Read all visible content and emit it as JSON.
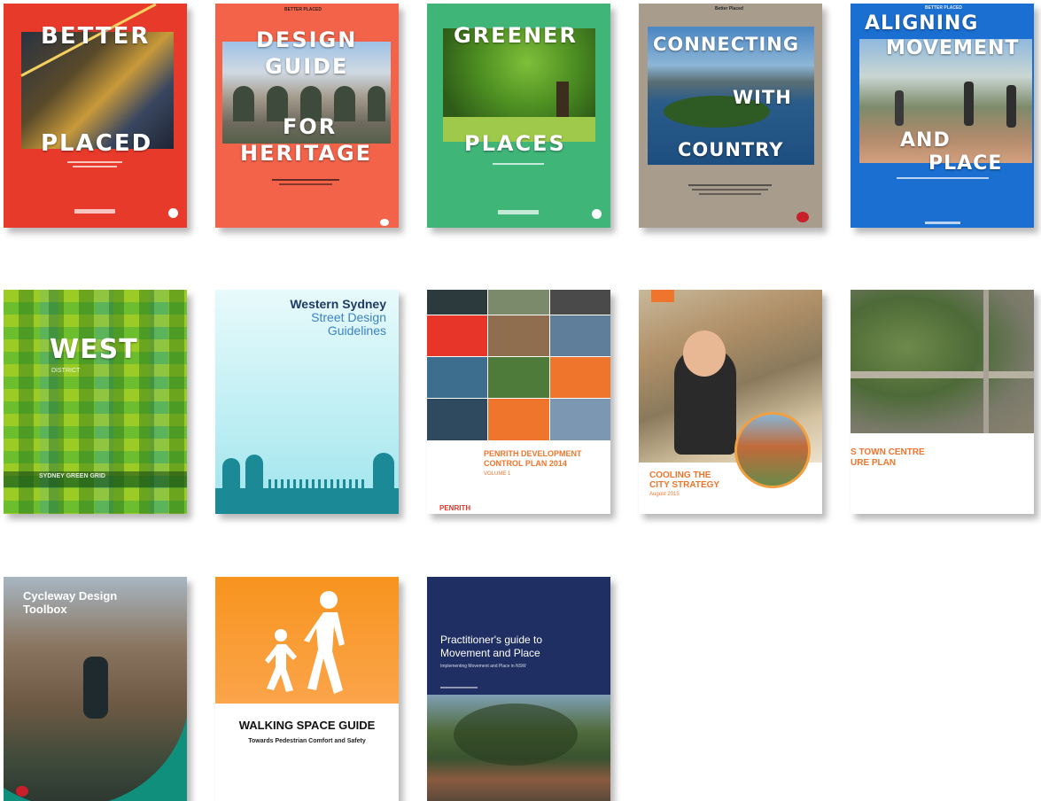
{
  "colors": {
    "better_placed_red": "#e83a2a",
    "heritage_coral": "#f2634a",
    "greener_green": "#3fb578",
    "country_taupe": "#a89d8d",
    "aligning_blue": "#1a6fd1",
    "practitioner_navy": "#1f2f63",
    "walking_orange": "#f7931e",
    "penrith_orange": "#f0752c"
  },
  "covers": [
    {
      "id": "better-placed",
      "title_lines": [
        "BETTER",
        "PLACED"
      ]
    },
    {
      "id": "design-guide-heritage",
      "header": "BETTER PLACED",
      "title_lines": [
        "DESIGN",
        "GUIDE",
        "FOR",
        "HERITAGE"
      ]
    },
    {
      "id": "greener-places",
      "title_lines": [
        "GREENER",
        "PLACES"
      ]
    },
    {
      "id": "connecting-with-country",
      "header": "Better Placed",
      "title_lines": [
        "CONNECTING",
        "WITH",
        "COUNTRY"
      ]
    },
    {
      "id": "aligning-movement-place",
      "header": "BETTER PLACED",
      "title_lines": [
        "ALIGNING",
        "MOVEMENT",
        "AND",
        "PLACE"
      ]
    },
    {
      "id": "west-district",
      "title": "WEST",
      "subtitle": "DISTRICT",
      "footer": "SYDNEY GREEN GRID"
    },
    {
      "id": "western-sydney-street-design",
      "title_line1": "Western Sydney",
      "title_line2": "Street Design",
      "title_line3": "Guidelines"
    },
    {
      "id": "penrith-dcp",
      "title_line1": "PENRITH DEVELOPMENT",
      "title_line2": "CONTROL PLAN 2014",
      "volume": "VOLUME 1",
      "footer": "PENRITH"
    },
    {
      "id": "cooling-the-city",
      "title_line1": "COOLING THE",
      "title_line2": "CITY STRATEGY",
      "date": "August 2015"
    },
    {
      "id": "town-centre-plan",
      "title_line1": "S TOWN CENTRE",
      "title_line2": "URE PLAN"
    },
    {
      "id": "cycleway-design-toolbox",
      "title_line1": "Cycleway Design",
      "title_line2": "Toolbox"
    },
    {
      "id": "walking-space-guide",
      "title": "WALKING SPACE GUIDE",
      "subtitle": "Towards Pedestrian Comfort and Safety"
    },
    {
      "id": "practitioners-guide",
      "title_line1": "Practitioner's guide to",
      "title_line2": "Movement and Place",
      "subtitle": "Implementing Movement and Place in NSW"
    }
  ]
}
